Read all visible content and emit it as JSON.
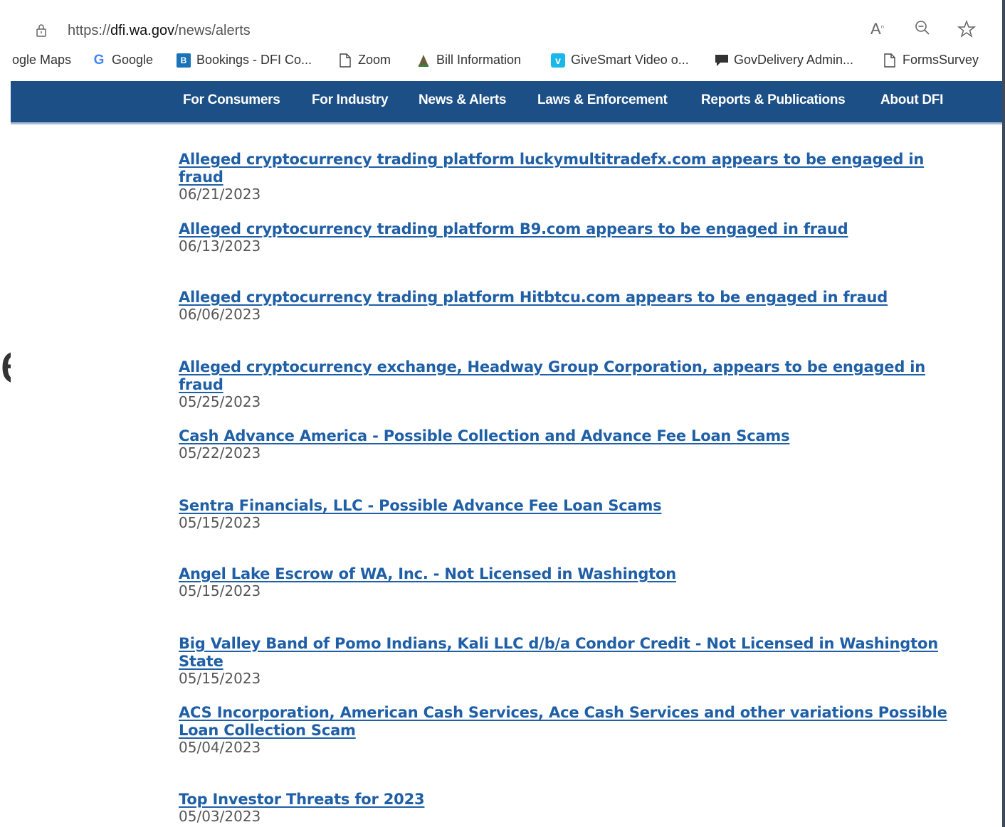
{
  "background_fragment": "ee",
  "browser": {
    "url_prefix": "https://",
    "url_domain": "dfi.wa.gov",
    "url_path": "/news/alerts",
    "icons": [
      "lock-icon",
      "read-aloud-icon",
      "zoom-icon",
      "favorite-star-icon"
    ]
  },
  "bookmarks": [
    {
      "label": "ogle Maps",
      "icon": "maps-icon"
    },
    {
      "label": "Google",
      "icon": "google-icon"
    },
    {
      "label": "Bookings - DFI Co...",
      "icon": "bookings-icon"
    },
    {
      "label": "Zoom",
      "icon": "page-icon"
    },
    {
      "label": "Bill Information",
      "icon": "capitol-icon"
    },
    {
      "label": "GiveSmart Video o...",
      "icon": "vimeo-icon"
    },
    {
      "label": "GovDelivery Admin...",
      "icon": "chat-icon"
    },
    {
      "label": "FormsSurvey",
      "icon": "page-icon"
    }
  ],
  "nav": [
    "For Consumers",
    "For Industry",
    "News & Alerts",
    "Laws & Enforcement",
    "Reports & Publications",
    "About DFI"
  ],
  "alerts": [
    {
      "title": "Alleged cryptocurrency trading platform luckymultitradefx.com appears to be engaged in fraud",
      "date": "06/21/2023"
    },
    {
      "title": "Alleged cryptocurrency trading platform B9.com appears to be engaged in fraud",
      "date": "06/13/2023"
    },
    {
      "title": "Alleged cryptocurrency trading platform Hitbtcu.com appears to be engaged in fraud",
      "date": "06/06/2023"
    },
    {
      "title": "Alleged cryptocurrency exchange, Headway Group Corporation, appears to be engaged in fraud",
      "date": "05/25/2023"
    },
    {
      "title": "Cash Advance America - Possible Collection and Advance Fee Loan Scams",
      "date": "05/22/2023"
    },
    {
      "title": "Sentra Financials, LLC - Possible Advance Fee Loan Scams",
      "date": "05/15/2023"
    },
    {
      "title": "Angel Lake Escrow of WA, Inc. - Not Licensed in Washington",
      "date": "05/15/2023"
    },
    {
      "title": "Big Valley Band of Pomo Indians, Kali LLC d/b/a Condor Credit - Not Licensed in Washington State",
      "date": "05/15/2023"
    },
    {
      "title": "ACS Incorporation, American Cash Services, Ace Cash Services and other variations Possible Loan Collection Scam",
      "date": "05/04/2023"
    },
    {
      "title": "Top Investor Threats for 2023",
      "date": "05/03/2023"
    }
  ],
  "colors": {
    "nav_bg": "#1c4f86",
    "link": "#1f5fa6",
    "date": "#555555"
  }
}
